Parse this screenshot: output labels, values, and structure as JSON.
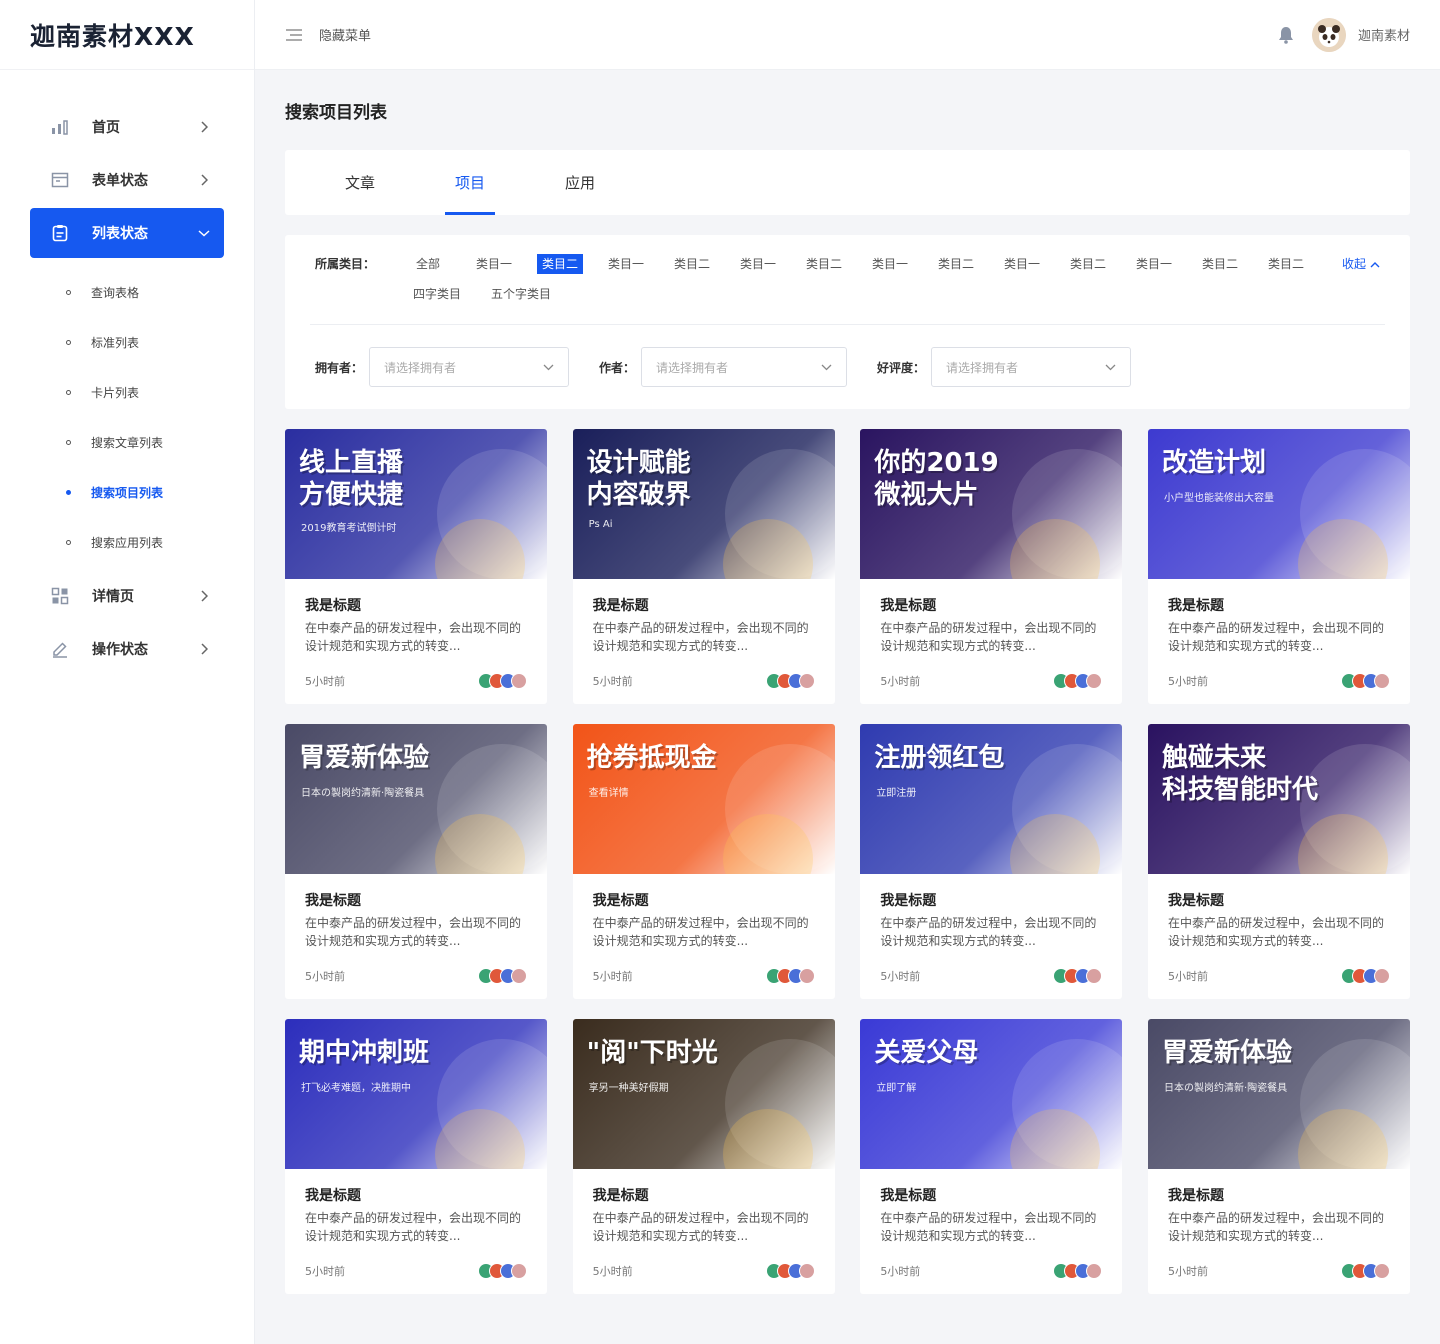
{
  "app": {
    "logo": "迦南素材XXX"
  },
  "header": {
    "toggle_label": "隐藏菜单",
    "username": "迦南素材"
  },
  "sidebar": {
    "items": [
      {
        "label": "首页",
        "icon": "bar-chart-icon"
      },
      {
        "label": "表单状态",
        "icon": "form-window-icon"
      },
      {
        "label": "列表状态",
        "icon": "clipboard-icon"
      },
      {
        "label": "详情页",
        "icon": "grid-layout-icon"
      },
      {
        "label": "操作状态",
        "icon": "edit-pen-icon"
      }
    ],
    "sub_items": [
      "查询表格",
      "标准列表",
      "卡片列表",
      "搜索文章列表",
      "搜索项目列表",
      "搜索应用列表"
    ]
  },
  "page": {
    "title": "搜索项目列表"
  },
  "tabs": [
    "文章",
    "项目",
    "应用"
  ],
  "filter": {
    "category_label": "所属类目：",
    "categories": [
      "全部",
      "类目一",
      "类目二",
      "类目一",
      "类目二",
      "类目一",
      "类目二",
      "类目一",
      "类目二",
      "类目一",
      "类目二",
      "类目一",
      "类目二",
      "类目二",
      "四字类目",
      "五个字类目"
    ],
    "collapse_label": "收起",
    "selects": [
      {
        "label": "拥有者：",
        "placeholder": "请选择拥有者"
      },
      {
        "label": "作者：",
        "placeholder": "请选择拥有者"
      },
      {
        "label": "好评度：",
        "placeholder": "请选择拥有者"
      }
    ]
  },
  "cards": [
    {
      "title": "我是标题",
      "desc": "在中泰产品的研发过程中，会出现不同的设计规范和实现方式的转变...",
      "time": "5小时前",
      "banner": "线上直播\n方便快捷",
      "banner_sub": "2019教育考试倒计时",
      "color": "#2a2ea0"
    },
    {
      "title": "我是标题",
      "desc": "在中泰产品的研发过程中，会出现不同的设计规范和实现方式的转变...",
      "time": "5小时前",
      "banner": "设计赋能\n内容破界",
      "banner_sub": "Ps  Ai",
      "color": "#1a1f5a"
    },
    {
      "title": "我是标题",
      "desc": "在中泰产品的研发过程中，会出现不同的设计规范和实现方式的转变...",
      "time": "5小时前",
      "banner": "你的2019\n微视大片",
      "banner_sub": "",
      "color": "#2a1460"
    },
    {
      "title": "我是标题",
      "desc": "在中泰产品的研发过程中，会出现不同的设计规范和实现方式的转变...",
      "time": "5小时前",
      "banner": "改造计划",
      "banner_sub": "小户型也能装修出大容量",
      "color": "#3d3ad0"
    },
    {
      "title": "我是标题",
      "desc": "在中泰产品的研发过程中，会出现不同的设计规范和实现方式的转变...",
      "time": "5小时前",
      "banner": "胃爱新体验",
      "banner_sub": "日本の製岗约清新·陶瓷餐具",
      "color": "#4a4a66"
    },
    {
      "title": "我是标题",
      "desc": "在中泰产品的研发过程中，会出现不同的设计规范和实现方式的转变...",
      "time": "5小时前",
      "banner": "抢券抵现金",
      "banner_sub": "查看详情",
      "color": "#f25418"
    },
    {
      "title": "我是标题",
      "desc": "在中泰产品的研发过程中，会出现不同的设计规范和实现方式的转变...",
      "time": "5小时前",
      "banner": "注册领红包",
      "banner_sub": "立即注册",
      "color": "#2f3bb0"
    },
    {
      "title": "我是标题",
      "desc": "在中泰产品的研发过程中，会出现不同的设计规范和实现方式的转变...",
      "time": "5小时前",
      "banner": "触碰未来\n科技智能时代",
      "banner_sub": "",
      "color": "#2a1260"
    },
    {
      "title": "我是标题",
      "desc": "在中泰产品的研发过程中，会出现不同的设计规范和实现方式的转变...",
      "time": "5小时前",
      "banner": "期中冲刺班",
      "banner_sub": "打飞必考难题，决胜期中",
      "color": "#2c2ebc"
    },
    {
      "title": "我是标题",
      "desc": "在中泰产品的研发过程中，会出现不同的设计规范和实现方式的转变...",
      "time": "5小时前",
      "banner": "\"阅\"下时光",
      "banner_sub": "享另一种美好假期",
      "color": "#3a2c1e"
    },
    {
      "title": "我是标题",
      "desc": "在中泰产品的研发过程中，会出现不同的设计规范和实现方式的转变...",
      "time": "5小时前",
      "banner": "关爱父母",
      "banner_sub": "立即了解",
      "color": "#3a3ad6"
    },
    {
      "title": "我是标题",
      "desc": "在中泰产品的研发过程中，会出现不同的设计规范和实现方式的转变...",
      "time": "5小时前",
      "banner": "胃爱新体验",
      "banner_sub": "日本の製岗约清新·陶瓷餐具",
      "color": "#4a4a66"
    }
  ]
}
